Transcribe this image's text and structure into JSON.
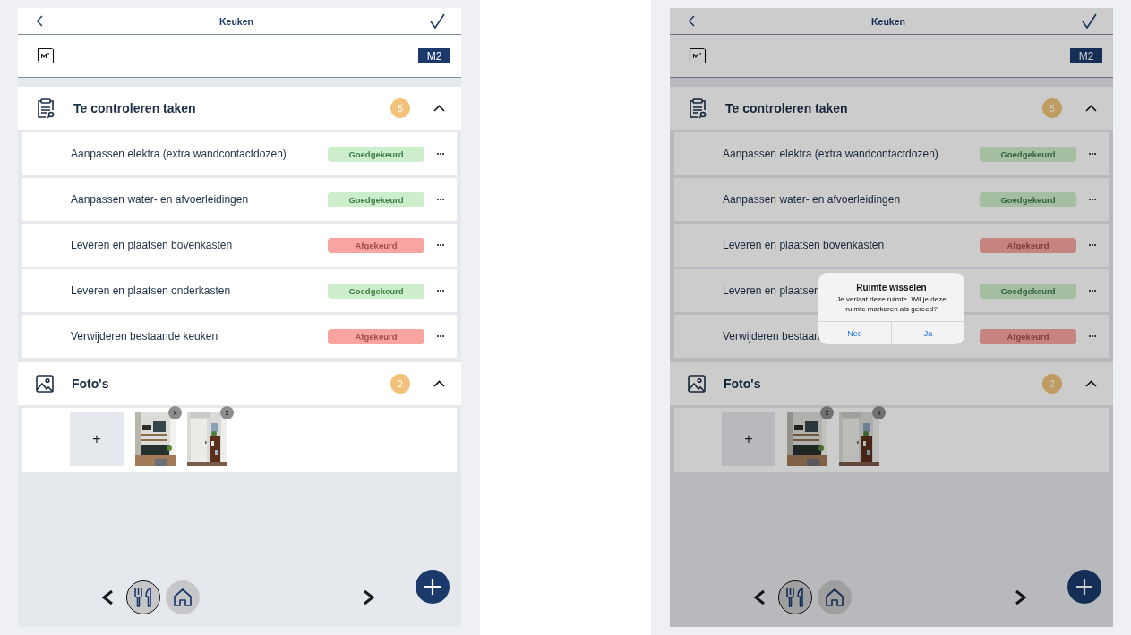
{
  "screens": [
    {
      "title": "Keuken",
      "unit": "M2",
      "dimmed": false,
      "sections": [
        {
          "kind": "tasks",
          "title": "Te controleren taken",
          "count": "5",
          "expanded": true,
          "tasks": [
            {
              "label": "Aanpassen elektra (extra wandcontactdozen)",
              "status": "Goedgekeurd",
              "approved": true
            },
            {
              "label": "Aanpassen water- en afvoerleidingen",
              "status": "Goedgekeurd",
              "approved": true
            },
            {
              "label": "Leveren en plaatsen bovenkasten",
              "status": "Afgekeurd",
              "approved": false
            },
            {
              "label": "Leveren en plaatsen onderkasten",
              "status": "Goedgekeurd",
              "approved": true
            },
            {
              "label": "Verwijderen bestaande keuken",
              "status": "Afgekeurd",
              "approved": false
            }
          ]
        },
        {
          "kind": "photos",
          "title": "Foto's",
          "count": "2",
          "expanded": true,
          "add": "+",
          "photos": [
            {
              "kind": "picture",
              "remove": "x"
            },
            {
              "kind": "picture",
              "remove": "x"
            }
          ]
        }
      ],
      "rooms": [
        {
          "selected": true
        },
        {
          "selected": false
        }
      ]
    },
    {
      "title": "Keuken",
      "unit": "M2",
      "dimmed": true,
      "sections": [
        {
          "kind": "tasks",
          "title": "Te controleren taken",
          "count": "5",
          "expanded": true,
          "tasks": [
            {
              "label": "Aanpassen elektra (extra wandcontactdozen)",
              "status": "Goedgekeurd",
              "approved": true
            },
            {
              "label": "Aanpassen water- en afvoerleidingen",
              "status": "Goedgekeurd",
              "approved": true
            },
            {
              "label": "Leveren en plaatsen bovenkasten",
              "status": "Afgekeurd",
              "approved": false
            },
            {
              "label": "Leveren en plaatsen",
              "status": "Goedgekeurd",
              "approved": true
            },
            {
              "label": "Verwijderen bestaan",
              "status": "Afgekeurd",
              "approved": false
            }
          ]
        },
        {
          "kind": "photos",
          "title": "Foto's",
          "count": "2",
          "expanded": true,
          "add": "+",
          "photos": [
            {
              "kind": "picture",
              "remove": "x"
            },
            {
              "kind": "picture",
              "remove": "x"
            }
          ]
        }
      ],
      "rooms": [
        {
          "selected": true
        },
        {
          "selected": false
        }
      ],
      "dialog": {
        "title": "Ruimte wisselen",
        "message": "Je verlaat deze ruimte. Wil je deze ruimte markeren als gereed?",
        "buttons": [
          "Nee",
          "Ja"
        ]
      }
    }
  ]
}
